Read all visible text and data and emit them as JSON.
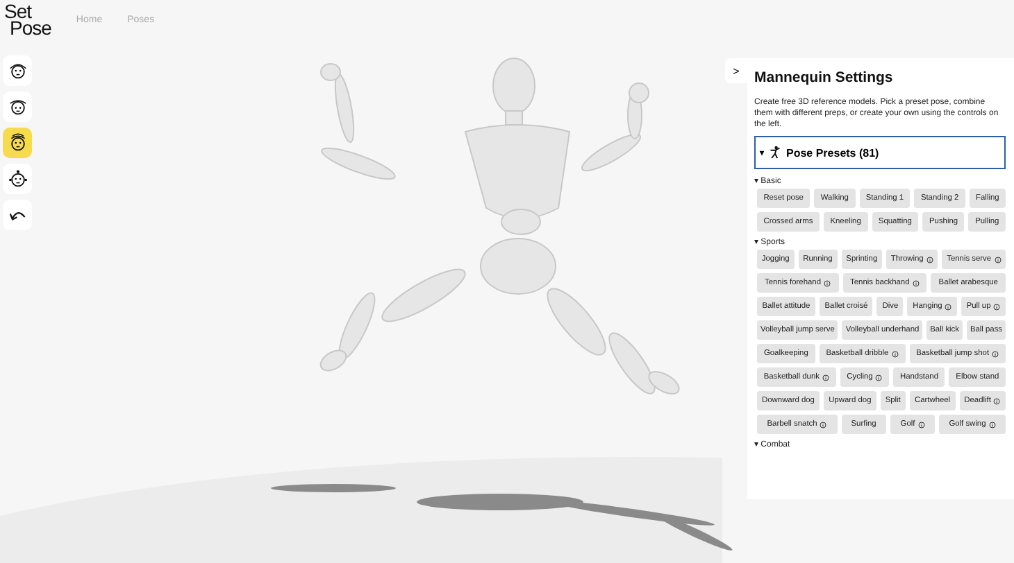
{
  "logo": {
    "line1": "Set",
    "line2": "Pose"
  },
  "nav": [
    {
      "label": "Home"
    },
    {
      "label": "Poses"
    }
  ],
  "toolbar": [
    {
      "kind": "face-front",
      "selected": false
    },
    {
      "kind": "face-tilt",
      "selected": false
    },
    {
      "kind": "face-up",
      "selected": true
    },
    {
      "kind": "joints",
      "selected": false
    },
    {
      "kind": "undo",
      "selected": false
    }
  ],
  "panel": {
    "toggle": ">",
    "title": "Mannequin Settings",
    "description": "Create free 3D reference models. Pick a preset pose, combine them with different preps, or create your own using the controls on the left.",
    "section": {
      "arrow": "▾",
      "title": "Pose Presets (81)",
      "expanded": true
    },
    "groups": [
      {
        "arrow": "▾",
        "title": "Basic",
        "presets": [
          {
            "label": "Reset pose",
            "info": false
          },
          {
            "label": "Walking",
            "info": false
          },
          {
            "label": "Standing 1",
            "info": false
          },
          {
            "label": "Standing 2",
            "info": false
          },
          {
            "label": "Falling",
            "info": false
          },
          {
            "label": "Crossed arms",
            "info": false
          },
          {
            "label": "Kneeling",
            "info": false
          },
          {
            "label": "Squatting",
            "info": false
          },
          {
            "label": "Pushing",
            "info": false
          },
          {
            "label": "Pulling",
            "info": false
          }
        ]
      },
      {
        "arrow": "▾",
        "title": "Sports",
        "presets": [
          {
            "label": "Jogging",
            "info": false
          },
          {
            "label": "Running",
            "info": false
          },
          {
            "label": "Sprinting",
            "info": false
          },
          {
            "label": "Throwing",
            "info": true
          },
          {
            "label": "Tennis serve",
            "info": true
          },
          {
            "label": "Tennis forehand",
            "info": true
          },
          {
            "label": "Tennis backhand",
            "info": true
          },
          {
            "label": "Ballet arabesque",
            "info": false
          },
          {
            "label": "Ballet attitude",
            "info": false
          },
          {
            "label": "Ballet croisé",
            "info": false
          },
          {
            "label": "Dive",
            "info": false
          },
          {
            "label": "Hanging",
            "info": true
          },
          {
            "label": "Pull up",
            "info": true
          },
          {
            "label": "Volleyball jump serve",
            "info": false
          },
          {
            "label": "Volleyball underhand",
            "info": false
          },
          {
            "label": "Ball kick",
            "info": false
          },
          {
            "label": "Ball pass",
            "info": false
          },
          {
            "label": "Goalkeeping",
            "info": false
          },
          {
            "label": "Basketball dribble",
            "info": true
          },
          {
            "label": "Basketball jump shot",
            "info": true
          },
          {
            "label": "Basketball dunk",
            "info": true
          },
          {
            "label": "Cycling",
            "info": true
          },
          {
            "label": "Handstand",
            "info": false
          },
          {
            "label": "Elbow stand",
            "info": false
          },
          {
            "label": "Downward dog",
            "info": false
          },
          {
            "label": "Upward dog",
            "info": false
          },
          {
            "label": "Split",
            "info": false
          },
          {
            "label": "Cartwheel",
            "info": false
          },
          {
            "label": "Deadlift",
            "info": true
          },
          {
            "label": "Barbell snatch",
            "info": true
          },
          {
            "label": "Surfing",
            "info": false
          },
          {
            "label": "Golf",
            "info": true
          },
          {
            "label": "Golf swing",
            "info": true
          }
        ]
      },
      {
        "arrow": "▾",
        "title": "Combat"
      }
    ]
  }
}
